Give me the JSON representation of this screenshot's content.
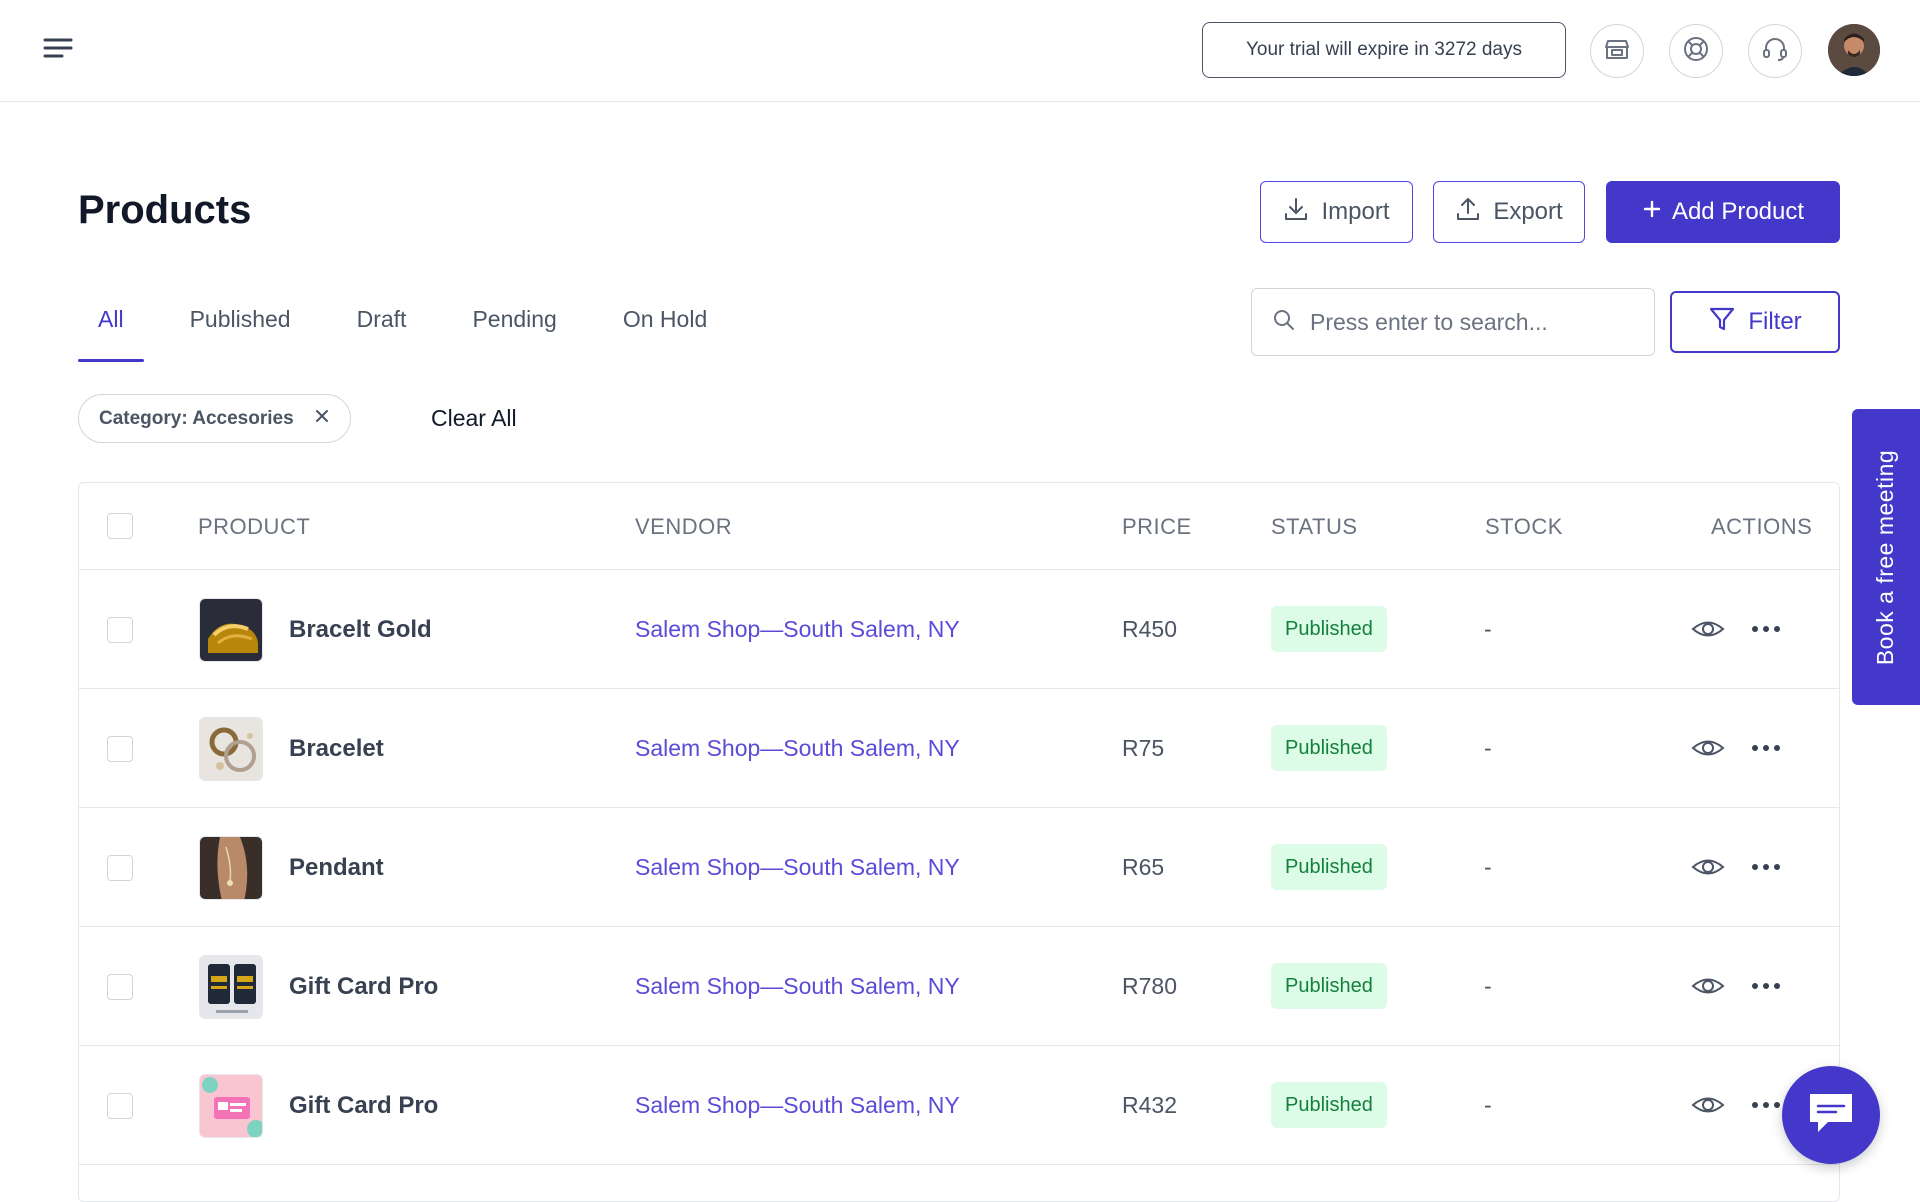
{
  "topbar": {
    "trial_text": "Your trial will expire in 3272 days",
    "icons": [
      "store-icon",
      "lifebuoy-icon",
      "headset-icon"
    ]
  },
  "header": {
    "title": "Products",
    "import_label": "Import",
    "export_label": "Export",
    "add_label": "Add Product"
  },
  "tabs": [
    {
      "label": "All",
      "active": true
    },
    {
      "label": "Published",
      "active": false
    },
    {
      "label": "Draft",
      "active": false
    },
    {
      "label": "Pending",
      "active": false
    },
    {
      "label": "On Hold",
      "active": false
    }
  ],
  "search": {
    "placeholder": "Press enter to search...",
    "value": ""
  },
  "filter_label": "Filter",
  "active_filter": {
    "label": "Category: Accesories"
  },
  "clear_all_label": "Clear All",
  "table": {
    "columns": [
      "PRODUCT",
      "VENDOR",
      "PRICE",
      "STATUS",
      "STOCK",
      "ACTIONS"
    ],
    "rows": [
      {
        "name": "Bracelt Gold",
        "vendor": "Salem Shop—South Salem, NY",
        "price": "R450",
        "status": "Published",
        "stock": "-"
      },
      {
        "name": "Bracelet",
        "vendor": "Salem Shop—South Salem, NY",
        "price": "R75",
        "status": "Published",
        "stock": "-"
      },
      {
        "name": "Pendant",
        "vendor": "Salem Shop—South Salem, NY",
        "price": "R65",
        "status": "Published",
        "stock": "-"
      },
      {
        "name": "Gift Card Pro",
        "vendor": "Salem Shop—South Salem, NY",
        "price": "R780",
        "status": "Published",
        "stock": "-"
      },
      {
        "name": "Gift Card Pro",
        "vendor": "Salem Shop—South Salem, NY",
        "price": "R432",
        "status": "Published",
        "stock": "-"
      }
    ]
  },
  "side_tab_label": "Book a free meeting",
  "colors": {
    "accent": "#4338ca",
    "status_published_bg": "#dcfce7",
    "status_published_text": "#15803d",
    "vendor_link": "#5b4bd8"
  }
}
